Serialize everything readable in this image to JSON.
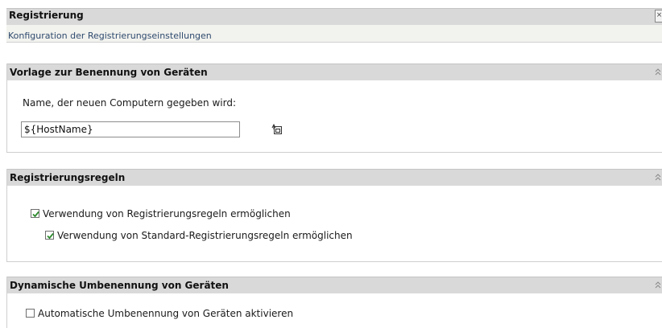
{
  "page": {
    "title": "Registrierung",
    "subtitle": "Konfiguration der Registrierungseinstellungen"
  },
  "naming": {
    "title": "Vorlage zur Benennung von Geräten",
    "label": "Name, der neuen Computern gegeben wird:",
    "value": "${HostName}",
    "browse_icon": "variable-picker-icon"
  },
  "rules": {
    "title": "Registrierungsregeln",
    "enable_rules": {
      "label": "Verwendung von Registrierungsregeln ermöglichen",
      "checked": true
    },
    "enable_default_rules": {
      "label": "Verwendung von Standard-Registrierungsregeln ermöglichen",
      "checked": true
    }
  },
  "rename": {
    "title": "Dynamische Umbenennung von Geräten",
    "auto_rename": {
      "label": "Automatische Umbenennung von Geräten aktivieren",
      "checked": false
    }
  },
  "colors": {
    "header_bg": "#d9d9d9",
    "subtitle_text": "#2e4a6e",
    "check_green": "#2e8b2e"
  }
}
